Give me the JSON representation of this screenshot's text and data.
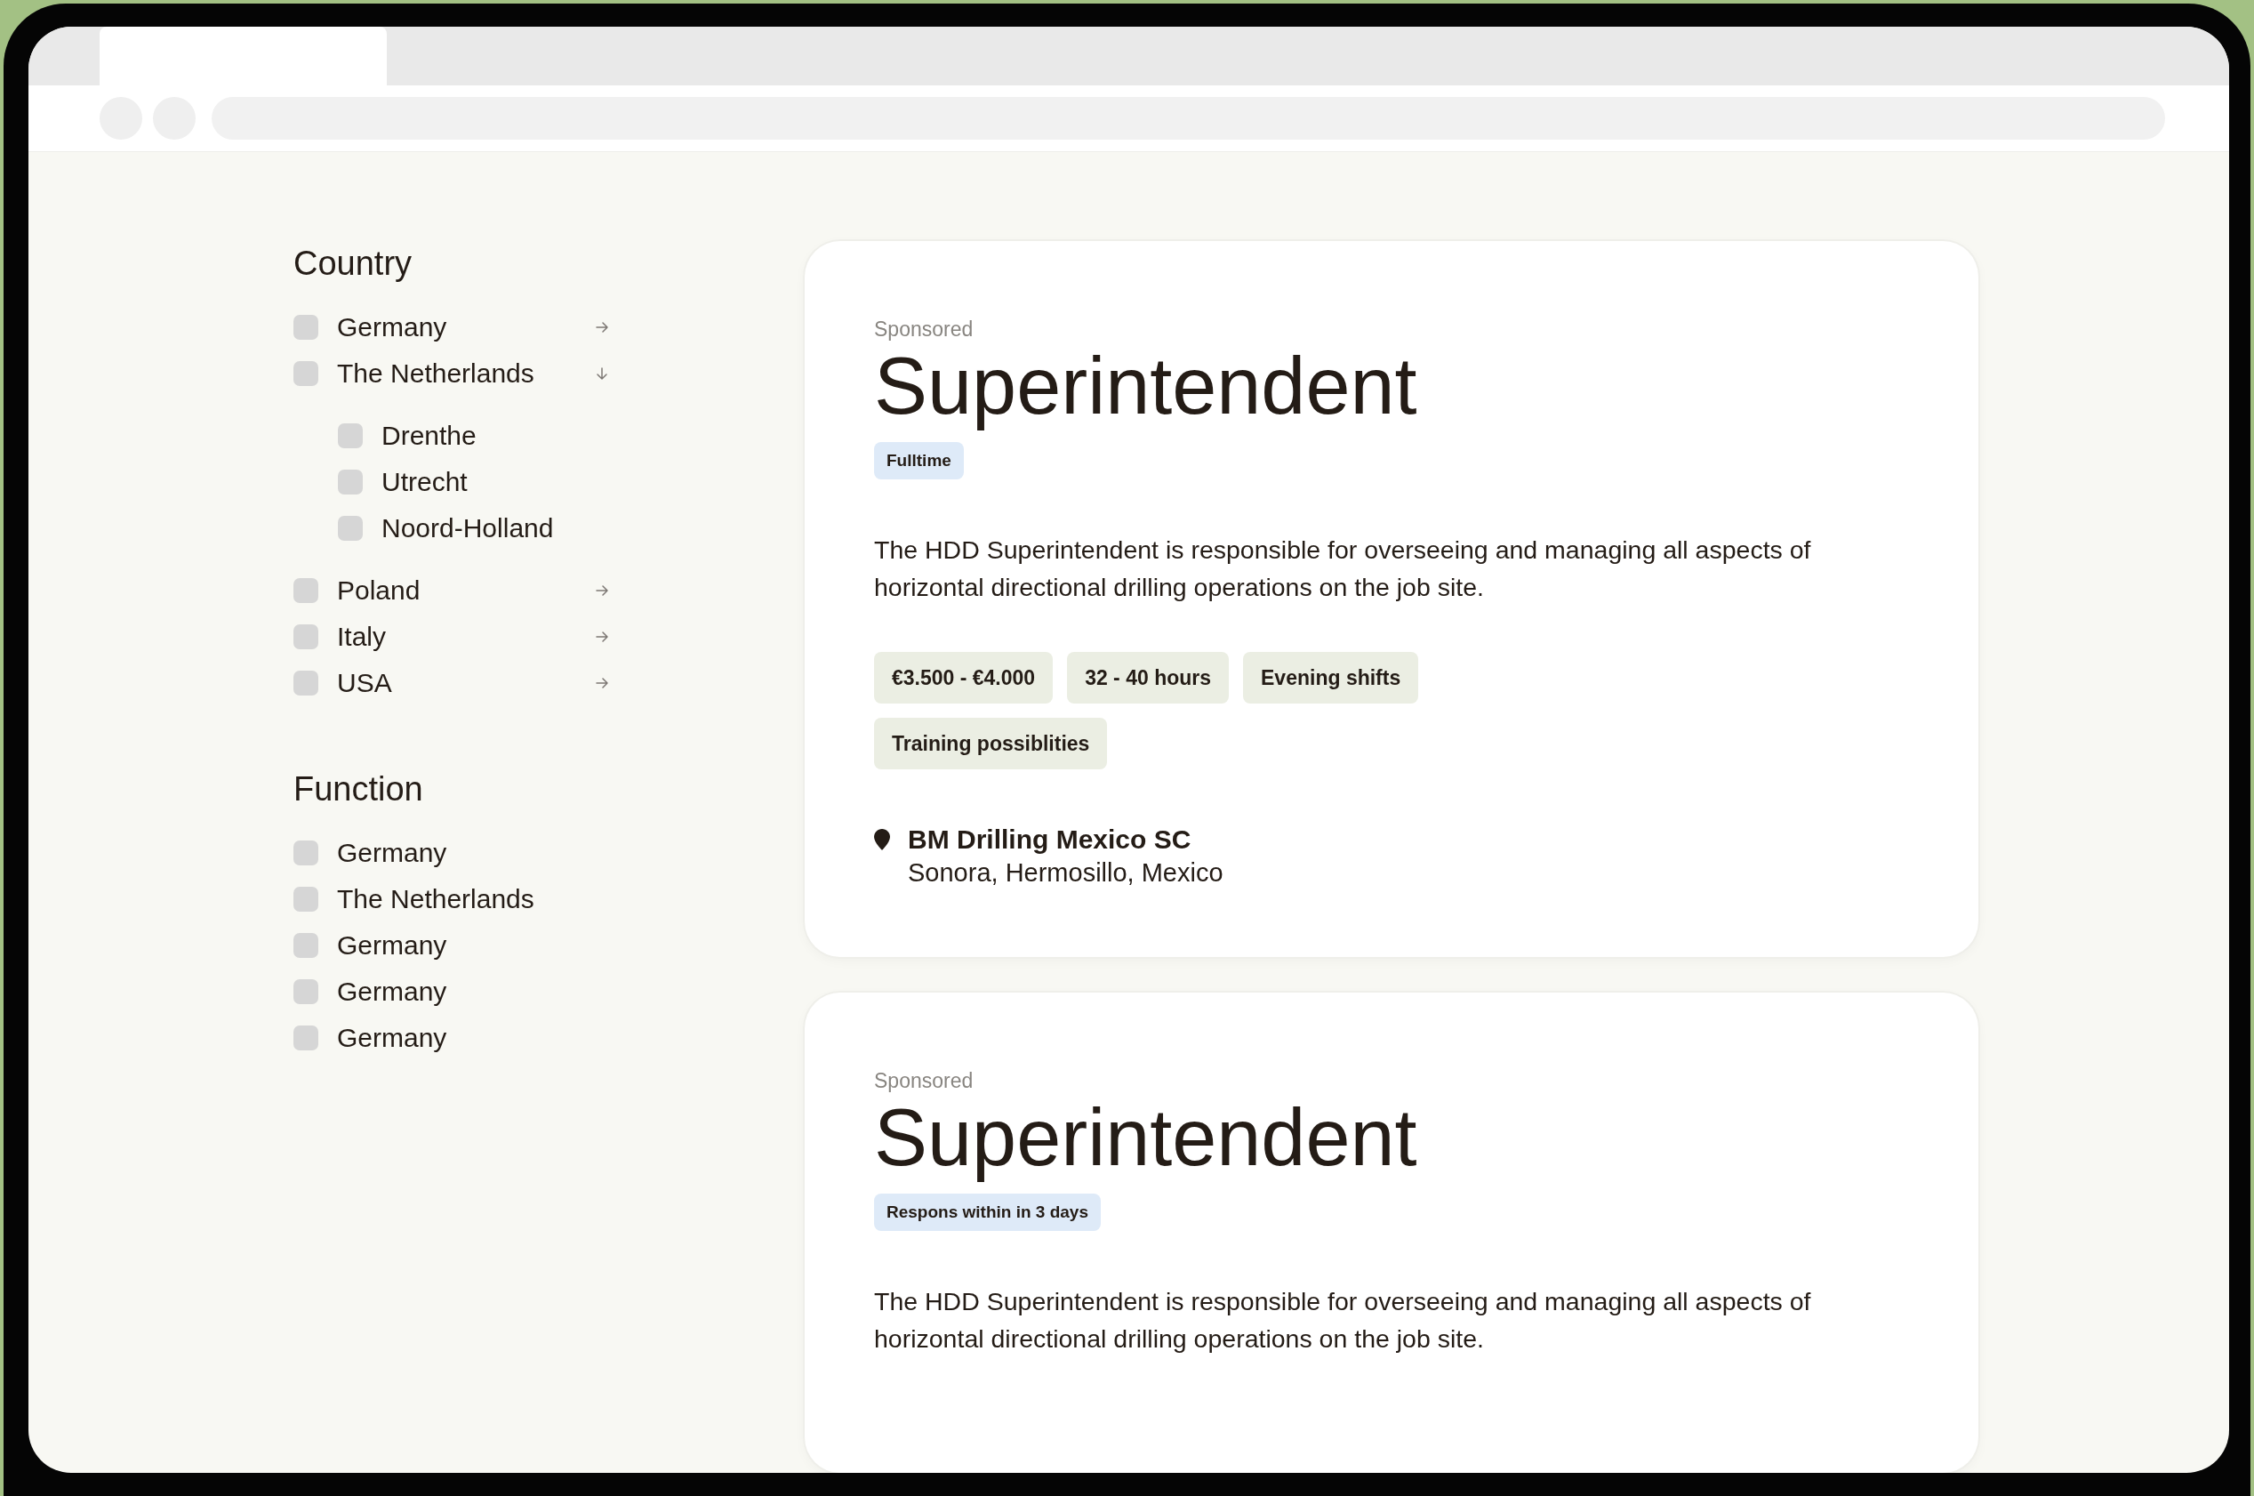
{
  "filters": [
    {
      "title": "Country",
      "items": [
        {
          "label": "Germany",
          "checked": false,
          "expanded": false
        },
        {
          "label": "The Netherlands",
          "checked": false,
          "expanded": true,
          "children": [
            {
              "label": "Drenthe",
              "checked": false
            },
            {
              "label": "Utrecht",
              "checked": false
            },
            {
              "label": "Noord-Holland",
              "checked": false
            }
          ]
        },
        {
          "label": "Poland",
          "checked": false,
          "expanded": false
        },
        {
          "label": "Italy",
          "checked": false,
          "expanded": false
        },
        {
          "label": "USA",
          "checked": false,
          "expanded": false
        }
      ]
    },
    {
      "title": "Function",
      "items": [
        {
          "label": "Germany",
          "checked": false
        },
        {
          "label": "The Netherlands",
          "checked": false
        },
        {
          "label": "Germany",
          "checked": false
        },
        {
          "label": "Germany",
          "checked": false
        },
        {
          "label": "Germany",
          "checked": false
        }
      ]
    }
  ],
  "jobs": [
    {
      "sponsored": "Sponsored",
      "title": "Superintendent",
      "badge": "Fulltime",
      "description": "The HDD Superintendent is responsible for overseeing and managing all aspects of horizontal directional drilling operations on the job site.",
      "tags": [
        "€3.500 - €4.000",
        "32 - 40 hours",
        "Evening shifts",
        "Training possiblities"
      ],
      "company": "BM Drilling Mexico SC",
      "location": "Sonora, Hermosillo, Mexico"
    },
    {
      "sponsored": "Sponsored",
      "title": "Superintendent",
      "badge": "Respons within in 3 days",
      "description": "The HDD Superintendent is responsible for overseeing and managing all aspects of horizontal directional drilling operations on the job site."
    }
  ]
}
